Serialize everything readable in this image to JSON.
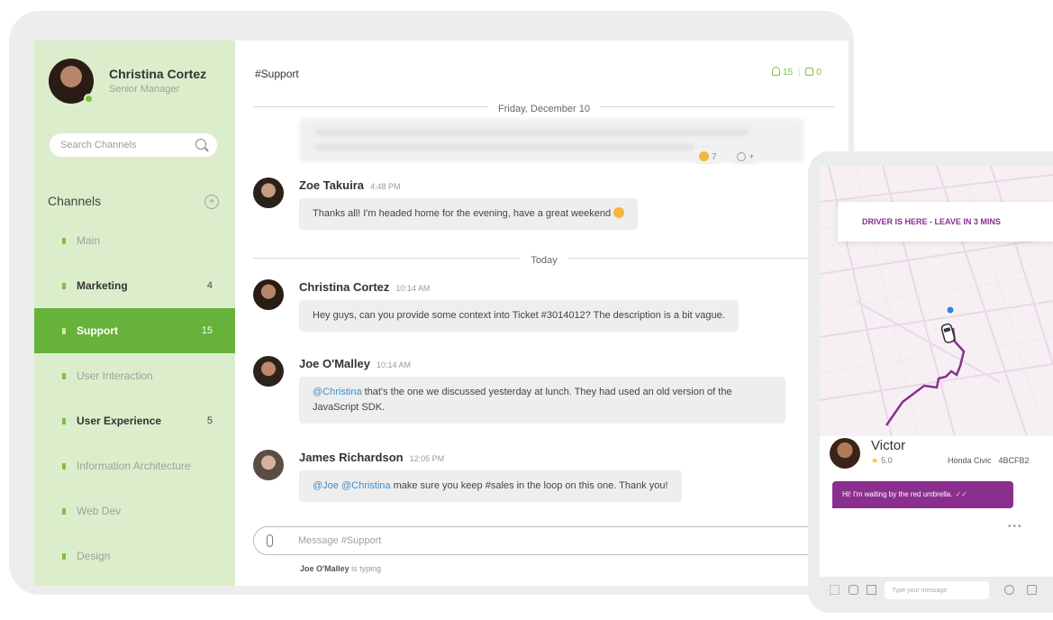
{
  "profile": {
    "name": "Christina Cortez",
    "role": "Senior Manager"
  },
  "search": {
    "placeholder": "Search Channels"
  },
  "sidebar": {
    "channels_title": "Channels",
    "channels": [
      {
        "label": "Main",
        "count": ""
      },
      {
        "label": "Marketing",
        "count": "4"
      },
      {
        "label": "Support",
        "count": "15"
      },
      {
        "label": "User Interaction",
        "count": ""
      },
      {
        "label": "User Experience",
        "count": "5"
      },
      {
        "label": "Information Architecture",
        "count": ""
      },
      {
        "label": "Web Dev",
        "count": ""
      },
      {
        "label": "Design",
        "count": ""
      }
    ]
  },
  "chat": {
    "title": "#Support",
    "members_count": "15",
    "likes_count": "0",
    "divider_friday": "Friday, December 10",
    "divider_today": "Today",
    "reactions": {
      "emoji_count": "7",
      "add": "+"
    },
    "messages": [
      {
        "author": "Zoe Takuira",
        "time": "4:48 PM",
        "text": "Thanks all! I'm headed home for the evening, have a great weekend"
      },
      {
        "author": "Christina Cortez",
        "time": "10:14 AM",
        "text": "Hey guys, can you provide some context into Ticket #3014012? The description is a bit vague."
      },
      {
        "author": "Joe O'Malley",
        "time": "10:14 AM",
        "mention": "@Christina",
        "text_line1": " that's the one we discussed yesterday at lunch. They had used an old version of the",
        "text_line2": "JavaScript SDK."
      },
      {
        "author": "James Richardson",
        "time": "12:05 PM",
        "mention1": "@Joe",
        "mention2": "@Christina",
        "text": " make sure you keep #sales in the loop on this one. Thank you!"
      }
    ],
    "composer_placeholder": "Message #Support",
    "typing_user": "Joe O'Malley",
    "typing_suffix": " is typing"
  },
  "phone": {
    "banner": "DRIVER IS HERE - LEAVE IN 3 MINS",
    "driver_name": "Victor",
    "rating": "5.0",
    "car_model": "Honda Civic",
    "plate": "4BCFB2",
    "message": "Hi! I'm waiting by the red umbrella.",
    "input_placeholder": "Type your message"
  },
  "colors": {
    "accent": "#66b23b",
    "sidebar_bg": "#dcedcb",
    "ride_purple": "#8b2f8f",
    "mention": "#3b8fd0"
  },
  "icons": [
    "search-icon",
    "add-channel-icon",
    "members-icon",
    "like-icon",
    "attach-icon",
    "emoji-icon",
    "star-icon",
    "camera-icon",
    "grid-icon",
    "gallery-icon",
    "thumbs-up-icon",
    "car-icon",
    "location-pin-icon"
  ]
}
